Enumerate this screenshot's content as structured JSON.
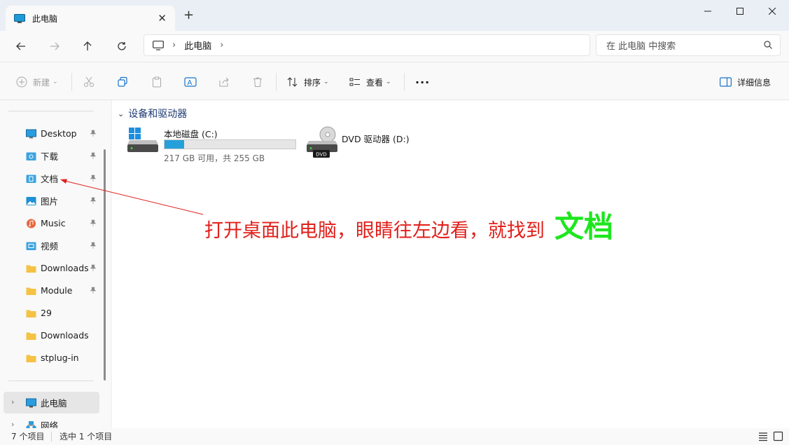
{
  "tab": {
    "title": "此电脑"
  },
  "address": {
    "crumb": "此电脑"
  },
  "search": {
    "placeholder": "在 此电脑 中搜索"
  },
  "toolbar": {
    "new_label": "新建",
    "sort_label": "排序",
    "view_label": "查看",
    "more_label": "···",
    "details_label": "详细信息"
  },
  "sidebar": {
    "items": [
      {
        "label": "Desktop",
        "icon": "desktop-icon",
        "pinned": true
      },
      {
        "label": "下载",
        "icon": "downloads-folder-icon",
        "pinned": true
      },
      {
        "label": "文档",
        "icon": "documents-folder-icon",
        "pinned": true
      },
      {
        "label": "图片",
        "icon": "pictures-icon",
        "pinned": true
      },
      {
        "label": "Music",
        "icon": "music-icon",
        "pinned": true
      },
      {
        "label": "视频",
        "icon": "videos-folder-icon",
        "pinned": true
      },
      {
        "label": "Downloads",
        "icon": "folder-icon",
        "pinned": true
      },
      {
        "label": "Module",
        "icon": "folder-icon",
        "pinned": true
      },
      {
        "label": "29",
        "icon": "folder-icon",
        "pinned": false
      },
      {
        "label": "Downloads",
        "icon": "folder-icon",
        "pinned": false
      },
      {
        "label": "stplug-in",
        "icon": "folder-icon",
        "pinned": false
      }
    ],
    "this_pc": "此电脑",
    "network": "网络"
  },
  "main": {
    "group_title": "设备和驱动器",
    "drive_c": {
      "name": "本地磁盘 (C:)",
      "space": "217 GB 可用，共 255 GB",
      "used_fraction": 0.149
    },
    "drive_d": {
      "name": "DVD 驱动器 (D:)",
      "badge": "DVD"
    }
  },
  "annotation": {
    "text": "打开桌面此电脑，眼睛往左边看，就找到",
    "highlight": "文档",
    "color": "#e0201b",
    "highlight_color": "#1ee61e"
  },
  "status": {
    "count": "7 个项目",
    "selected": "选中 1 个项目"
  },
  "colors": {
    "accent": "#26a0da",
    "window_bg": "#f3f3f3"
  }
}
